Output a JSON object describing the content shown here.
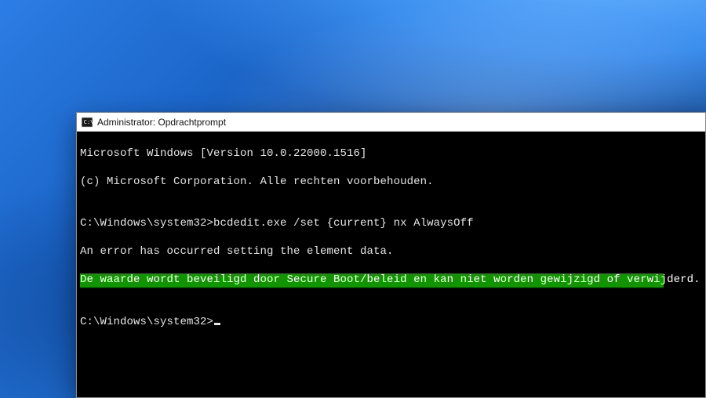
{
  "window": {
    "title": "Administrator: Opdrachtprompt",
    "icon": "cmd-icon"
  },
  "terminal": {
    "line_version": "Microsoft Windows [Version 10.0.22000.1516]",
    "line_copyright": "(c) Microsoft Corporation. Alle rechten voorbehouden.",
    "blank1": "",
    "prompt1": "C:\\Windows\\system32>bcdedit.exe /set {current} nx AlwaysOff",
    "error1": "An error has occurred setting the element data.",
    "error2_highlighted": "De waarde wordt beveiligd door Secure Boot/beleid en kan niet worden gewijzigd of verwijderd.",
    "blank2": "",
    "prompt2": "C:\\Windows\\system32>"
  },
  "colors": {
    "highlight_bg": "#119400",
    "terminal_bg": "#000000",
    "terminal_fg": "#e6e6e6"
  }
}
